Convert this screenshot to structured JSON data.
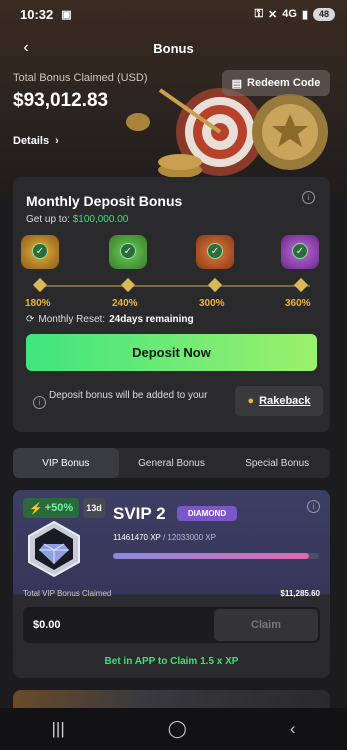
{
  "status": {
    "time": "10:32",
    "network": "4G",
    "battery": "48"
  },
  "header": {
    "title": "Bonus"
  },
  "summary": {
    "label": "Total Bonus Claimed (USD)",
    "value": "$93,012.83",
    "redeem_label": "Redeem Code",
    "details_label": "Details"
  },
  "monthly": {
    "title": "Monthly Deposit Bonus",
    "getup_prefix": "Get up to:",
    "getup_value": "$100,000.00",
    "milestones": [
      "180%",
      "240%",
      "300%",
      "360%"
    ],
    "reset_prefix": "Monthly Reset:",
    "reset_value": "24days remaining",
    "deposit_label": "Deposit Now",
    "note": "Deposit bonus will be added to your",
    "rakeback_label": "Rakeback"
  },
  "tabs": [
    "VIP Bonus",
    "General Bonus",
    "Special Bonus"
  ],
  "vip": {
    "boost": "+50%",
    "days": "13d",
    "name": "SVIP 2",
    "badge": "DIAMOND",
    "xp_current": "11461470 XP",
    "xp_target": "/ 12033000 XP",
    "progress": 0.9525,
    "total_label": "Total VIP Bonus Claimed",
    "total_value": "$11,285.60",
    "claim_amount": "$0.00",
    "claim_label": "Claim",
    "promo": "Bet in APP to Claim 1.5 x XP"
  },
  "colors": {
    "accent_green": "#3ee07a",
    "gold": "#e8b63a",
    "diamond": "#7c55c8"
  }
}
